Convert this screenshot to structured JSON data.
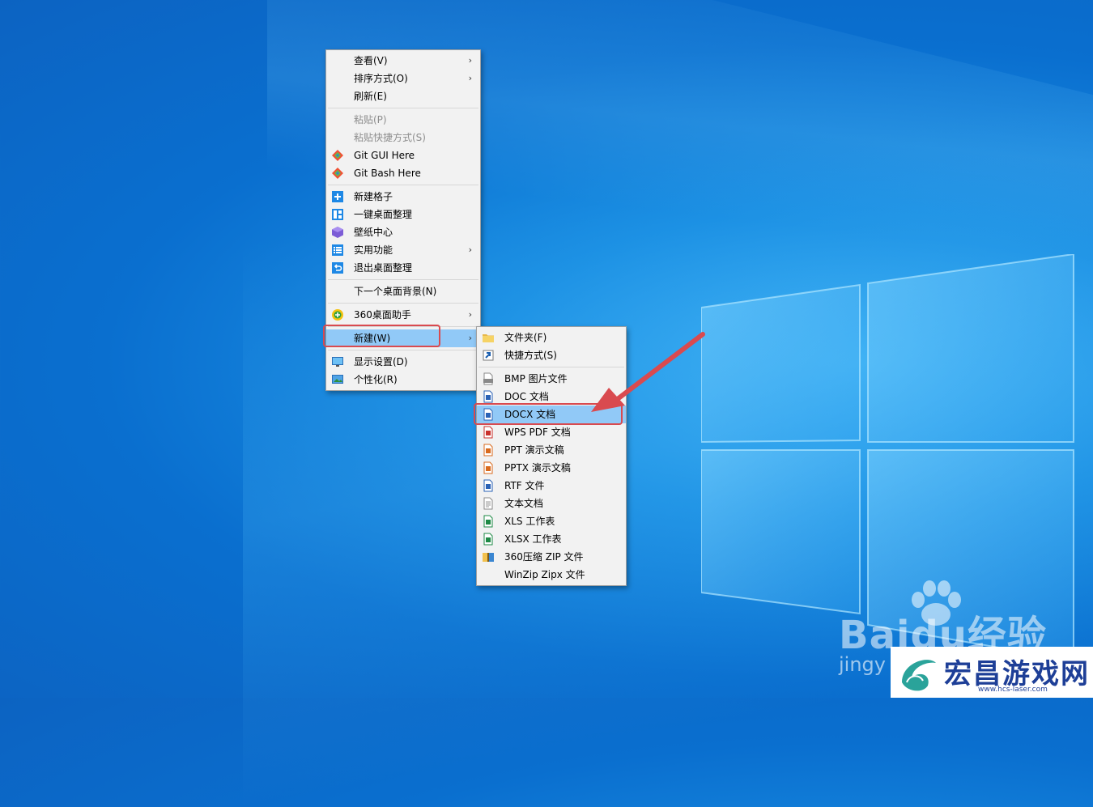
{
  "main_menu": {
    "items": [
      {
        "label": "查看(V)",
        "submenu": true,
        "icon": ""
      },
      {
        "label": "排序方式(O)",
        "submenu": true,
        "icon": ""
      },
      {
        "label": "刷新(E)",
        "icon": ""
      },
      {
        "label": "粘贴(P)",
        "disabled": true,
        "icon": ""
      },
      {
        "label": "粘贴快捷方式(S)",
        "disabled": true,
        "icon": ""
      },
      {
        "label": "Git GUI Here",
        "icon": "git-icon"
      },
      {
        "label": "Git Bash Here",
        "icon": "git-icon"
      },
      {
        "label": "新建格子",
        "icon": "plus-box-icon"
      },
      {
        "label": "一键桌面整理",
        "icon": "layout-icon"
      },
      {
        "label": "壁纸中心",
        "icon": "cube-icon"
      },
      {
        "label": "实用功能",
        "submenu": true,
        "icon": "list-icon"
      },
      {
        "label": "退出桌面整理",
        "icon": "exit-icon"
      },
      {
        "label": "下一个桌面背景(N)",
        "icon": ""
      },
      {
        "label": "360桌面助手",
        "submenu": true,
        "icon": "360-icon"
      },
      {
        "label": "新建(W)",
        "submenu": true,
        "icon": ""
      },
      {
        "label": "显示设置(D)",
        "icon": "monitor-icon"
      },
      {
        "label": "个性化(R)",
        "icon": "personalize-icon"
      }
    ]
  },
  "sub_menu": {
    "items": [
      {
        "label": "文件夹(F)",
        "icon": "folder-icon"
      },
      {
        "label": "快捷方式(S)",
        "icon": "shortcut-icon"
      },
      {
        "label": "BMP 图片文件",
        "icon": "bmp-icon"
      },
      {
        "label": "DOC 文档",
        "icon": "word-icon"
      },
      {
        "label": "DOCX 文档",
        "icon": "word-icon"
      },
      {
        "label": "WPS PDF 文档",
        "icon": "pdf-icon"
      },
      {
        "label": "PPT 演示文稿",
        "icon": "ppt-icon"
      },
      {
        "label": "PPTX 演示文稿",
        "icon": "ppt-icon"
      },
      {
        "label": "RTF 文件",
        "icon": "word-icon"
      },
      {
        "label": "文本文档",
        "icon": "text-file-icon"
      },
      {
        "label": "XLS 工作表",
        "icon": "excel-icon"
      },
      {
        "label": "XLSX 工作表",
        "icon": "excel-icon"
      },
      {
        "label": "360压缩 ZIP 文件",
        "icon": "zip-icon"
      },
      {
        "label": "WinZip Zipx 文件",
        "icon": ""
      }
    ]
  },
  "colors": {
    "highlight": "#91c9f7",
    "annotation_red": "#d94a4f",
    "menu_bg": "#f2f2f2",
    "desktop_blue": "#0a6fcf"
  },
  "watermark": {
    "baidu_logo": "Bai",
    "baidu_logo_tail": "du",
    "baidu_cn": "经验",
    "baidu_sub": "jingy",
    "site_name": "宏昌游戏网",
    "site_url": "www.hcs-laser.com"
  }
}
